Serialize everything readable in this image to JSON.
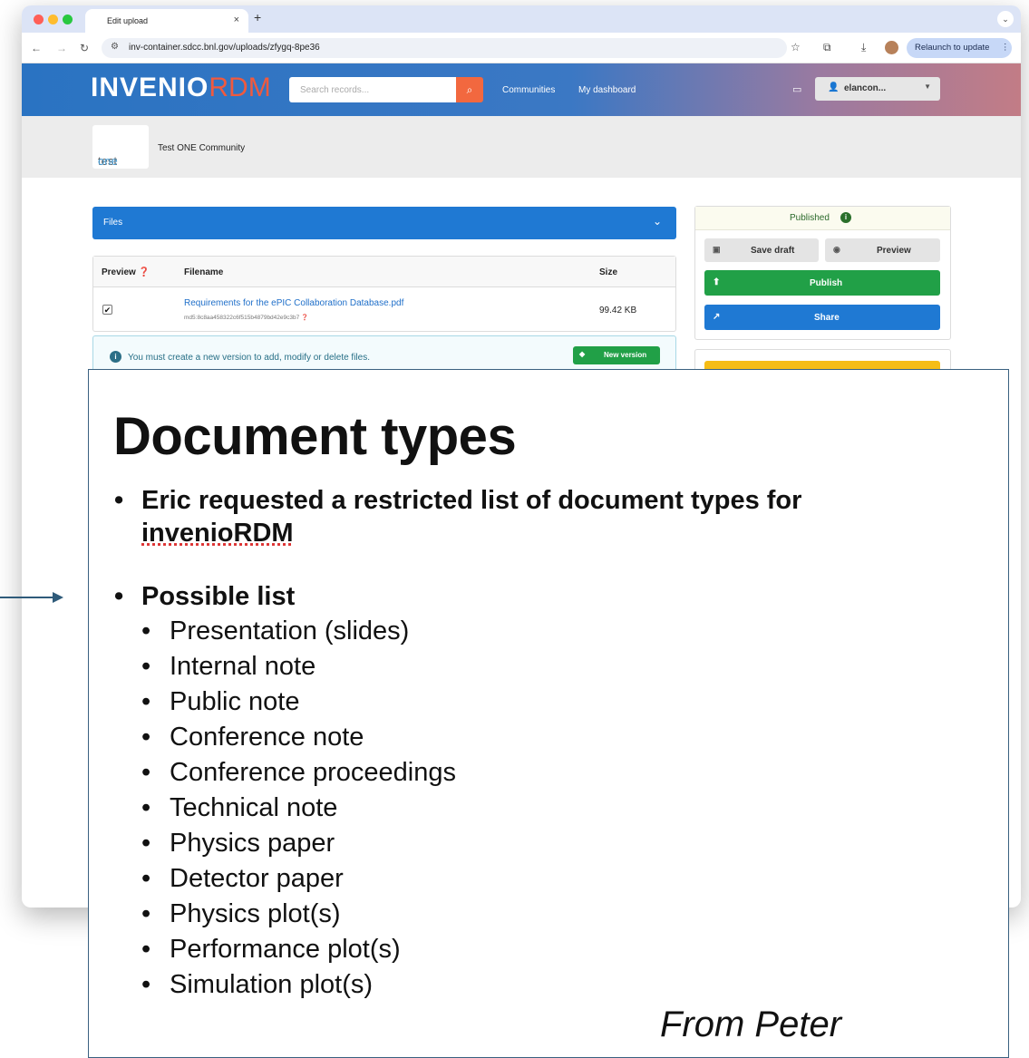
{
  "browser": {
    "tab_title": "Edit upload",
    "tab_close": "×",
    "new_tab": "+",
    "url": "inv-container.sdcc.bnl.gov/uploads/zfygq-8pe36",
    "relaunch": "Relaunch to update",
    "relaunch_menu": "⋮"
  },
  "header": {
    "logo_main": "INVENIO",
    "logo_accent": "RDM",
    "search_placeholder": "Search records...",
    "nav": [
      "Communities",
      "My dashboard"
    ],
    "user": "elancon..."
  },
  "community": {
    "logo_text_a": "test",
    "logo_text_b": "one",
    "name": "Test ONE Community"
  },
  "files": {
    "section_label": "Files",
    "columns": [
      "Preview",
      "Filename",
      "Size"
    ],
    "row": {
      "checked": true,
      "filename": "Requirements for the ePIC Collaboration Database.pdf",
      "md5": "md5:8c8aa458322c6f515b4879bd42e9c3b7",
      "size": "99.42 KB"
    },
    "notice": "You must create a new version to add, modify or delete files.",
    "new_version": "New version"
  },
  "sidebar": {
    "status": "Published",
    "save_draft": "Save draft",
    "preview": "Preview",
    "publish": "Publish",
    "share": "Share"
  },
  "slide": {
    "title": "Document types",
    "bullet1_line1": "Eric requested a restricted list of document types for",
    "bullet1_line2": "invenioRDM",
    "bullet2": "Possible list",
    "items": [
      "Presentation (slides)",
      "Internal note",
      "Public note",
      "Conference note",
      "Conference proceedings",
      "Technical note",
      "Physics paper",
      "Detector paper",
      "Physics plot(s)",
      "Performance plot(s)",
      "Simulation plot(s)"
    ],
    "footer": "From Peter"
  },
  "colors": {
    "files_bar": "#1f79d3",
    "publish": "#21a047",
    "share": "#1f79d3",
    "search_button": "#f2683f",
    "slide_border": "#3a6180"
  }
}
